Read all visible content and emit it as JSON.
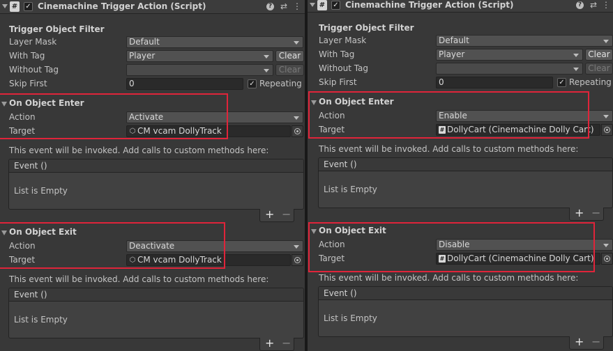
{
  "left": {
    "title": "Cinemachine Trigger Action (Script)",
    "script_icon": "#",
    "filter_header": "Trigger Object Filter",
    "layer_mask_label": "Layer Mask",
    "layer_mask_value": "Default",
    "with_tag_label": "With Tag",
    "with_tag_value": "Player",
    "clear_label": "Clear",
    "without_tag_label": "Without Tag",
    "without_tag_value": "",
    "clear2_label": "Clear",
    "skip_first_label": "Skip First",
    "skip_first_value": "0",
    "repeating_label": "Repeating",
    "enter": {
      "header": "On Object Enter",
      "action_label": "Action",
      "action_value": "Activate",
      "target_label": "Target",
      "target_value": "CM vcam DollyTrack",
      "target_icon": "⬡",
      "hint": "This event will be invoked.  Add calls to custom methods here:",
      "event_title": "Event ()",
      "list_empty": "List is Empty"
    },
    "exit": {
      "header": "On Object Exit",
      "action_label": "Action",
      "action_value": "Deactivate",
      "target_label": "Target",
      "target_value": "CM vcam DollyTrack",
      "target_icon": "⬡",
      "hint": "This event will be invoked.  Add calls to custom methods here:",
      "event_title": "Event ()",
      "list_empty": "List is Empty"
    }
  },
  "right": {
    "title": "Cinemachine Trigger Action (Script)",
    "script_icon": "#",
    "filter_header": "Trigger Object Filter",
    "layer_mask_label": "Layer Mask",
    "layer_mask_value": "Default",
    "with_tag_label": "With Tag",
    "with_tag_value": "Player",
    "clear_label": "Clear",
    "without_tag_label": "Without Tag",
    "without_tag_value": "",
    "clear2_label": "Clear",
    "skip_first_label": "Skip First",
    "skip_first_value": "0",
    "repeating_label": "Repeating",
    "enter": {
      "header": "On Object Enter",
      "action_label": "Action",
      "action_value": "Enable",
      "target_label": "Target",
      "target_value": "DollyCart (Cinemachine Dolly Cart)",
      "target_icon": "#",
      "hint": "This event will be invoked.  Add calls to custom methods here:",
      "event_title": "Event ()",
      "list_empty": "List is Empty"
    },
    "exit": {
      "header": "On Object Exit",
      "action_label": "Action",
      "action_value": "Disable",
      "target_label": "Target",
      "target_value": "DollyCart (Cinemachine Dolly Cart)",
      "target_icon": "#",
      "hint": "This event will be invoked.  Add calls to custom methods here:",
      "event_title": "Event ()",
      "list_empty": "List is Empty"
    }
  },
  "icons": {
    "help": "?",
    "presets": "⇄",
    "menu": "⋮",
    "check": "✓",
    "plus": "+",
    "minus": "−"
  },
  "colors": {
    "background": "#383838",
    "highlight": "#e0243a",
    "text": "#c4c4c4"
  }
}
